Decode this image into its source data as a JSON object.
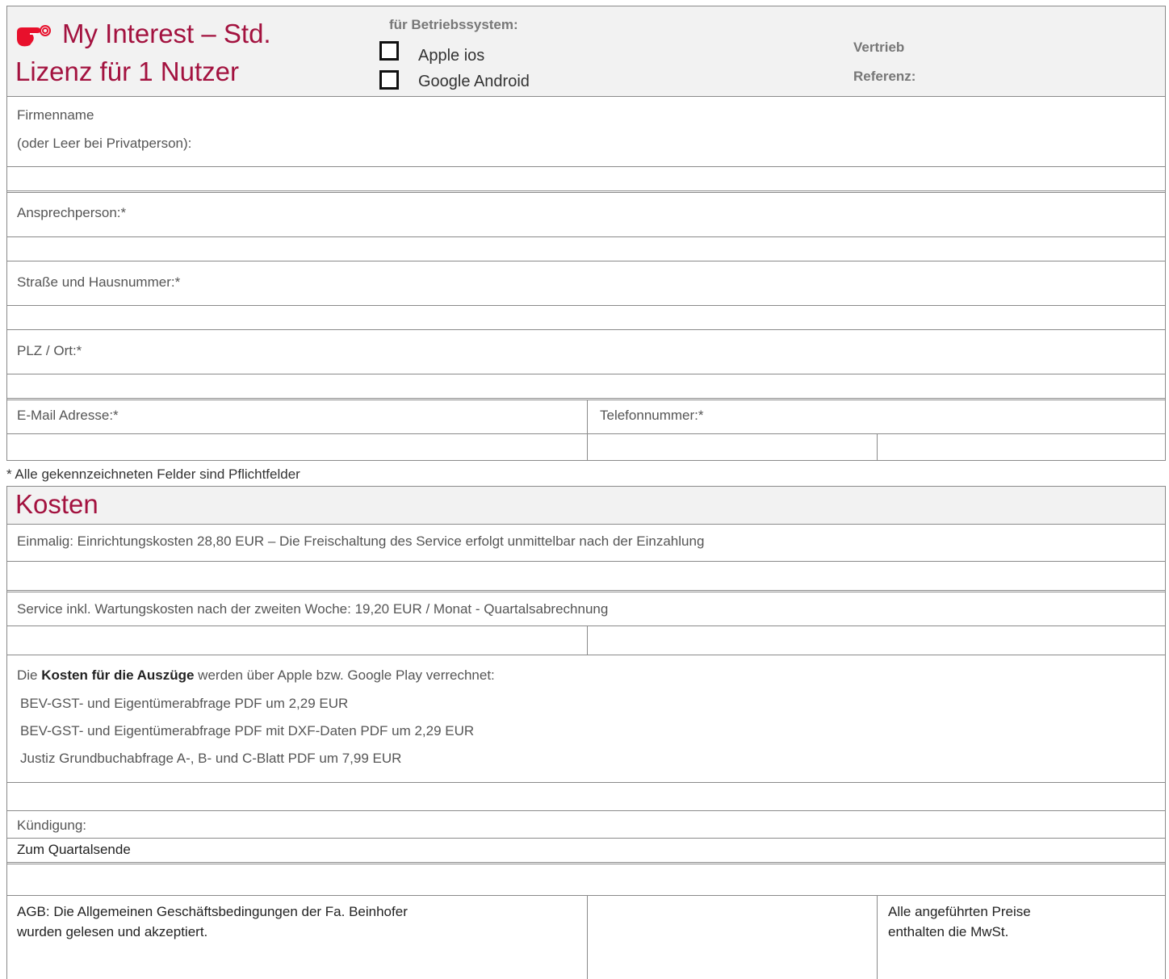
{
  "header": {
    "title_line1": "My Interest – Std.",
    "title_line2": "Lizenz für 1 Nutzer",
    "os_heading": "für Betriebssystem:",
    "os_options": [
      "Apple ios",
      "Google Android"
    ],
    "vertrieb_label": "Vertrieb",
    "referenz_label": "Referenz:",
    "icon": "pointing-hand-icon",
    "accent_color": "#a3123f"
  },
  "customer": {
    "company_label_line1": "Firmenname",
    "company_label_line2": "(oder Leer bei Privatperson):",
    "contact_label": "Ansprechperson:*",
    "street_label": "Straße und Hausnummer:*",
    "city_label": "PLZ / Ort:*",
    "email_label": "E-Mail Adresse:*",
    "phone_label": "Telefonnummer:*"
  },
  "required_note": "* Alle gekennzeichneten Felder sind Pflichtfelder",
  "costs": {
    "heading": "Kosten",
    "setup_text": "Einmalig: Einrichtungskosten 28,80 EUR – Die Freischaltung des Service erfolgt unmittelbar nach der Einzahlung",
    "service_text": "Service inkl. Wartungskosten nach der zweiten Woche: 19,20 EUR / Monat - Quartalsabrechnung",
    "extracts_prefix": "Die ",
    "extracts_bold": "Kosten für die Auszüge",
    "extracts_suffix": " werden über Apple bzw. Google Play verrechnet:",
    "extract_items": [
      "BEV-GST- und Eigentümerabfrage PDF um 2,29 EUR",
      "BEV-GST- und Eigentümerabfrage PDF mit DXF-Daten PDF um 2,29 EUR",
      "Justiz Grundbuchabfrage A-, B- und C-Blatt PDF um 7,99 EUR"
    ],
    "termination_label": "Kündigung:",
    "termination_value": "Zum Quartalsende",
    "agb_line1": "AGB: Die Allgemeinen Geschäftsbedingungen der Fa. Beinhofer",
    "agb_line2": "wurden gelesen und akzeptiert.",
    "vat_line1": "Alle angeführten Preise",
    "vat_line2": "enthalten die MwSt."
  }
}
